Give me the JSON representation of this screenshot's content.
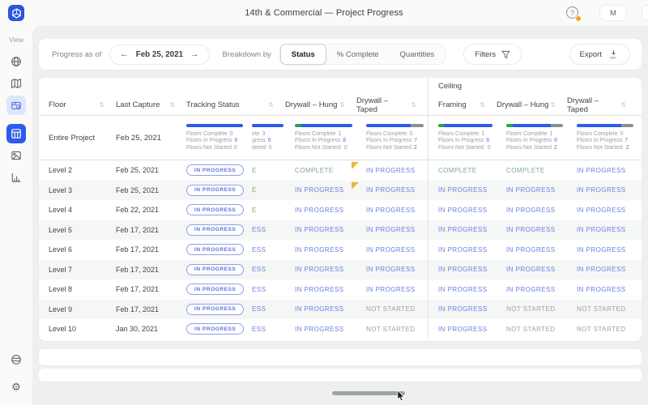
{
  "topbar": {
    "title": "14th & Commercial — Project Progress",
    "avatar_initial": "M"
  },
  "sidebar": {
    "view_label": "View",
    "items": [
      {
        "icon": "globe"
      },
      {
        "icon": "map"
      },
      {
        "icon": "capture-camera",
        "highlight": "soft"
      },
      {
        "icon": "progress-table",
        "highlight": "active"
      },
      {
        "icon": "photo-gallery"
      },
      {
        "icon": "bar-chart"
      }
    ],
    "bottom": [
      {
        "icon": "support-globe"
      },
      {
        "icon": "settings-gear"
      }
    ]
  },
  "toolbar": {
    "progress_as_of_label": "Progress as of",
    "prev_arrow": "←",
    "date": "Feb 25, 2021",
    "next_arrow": "→",
    "breakdown_label": "Breakdown by",
    "segments": [
      {
        "label": "Status",
        "selected": true
      },
      {
        "label": "% Complete",
        "selected": false
      },
      {
        "label": "Quantities",
        "selected": false
      }
    ],
    "filters_label": "Filters",
    "export_label": "Export",
    "export_format": "csv"
  },
  "colors": {
    "accent_blue": "#2d5bec",
    "bar_green": "#2ea052",
    "bar_gray": "#8b9097",
    "flag_yellow": "#f2b43c",
    "badge_orange": "#f5a623",
    "status_blue": "#6a7fe2",
    "status_green": "#7fab90",
    "status_gray": "#9da3a8"
  },
  "table": {
    "section_label": "Ceiling",
    "columns": [
      "Floor",
      "Last Capture",
      "Tracking Status",
      "Drywall – Hung",
      "Drywall – Taped",
      "Framing",
      "Drywall – Hung",
      "Drywall – Taped"
    ],
    "summary": {
      "floor": "Entire Project",
      "last_capture": "Feb 25, 2021",
      "metrics": [
        {
          "id": "tracking-status",
          "clipped": false,
          "bar": [
            {
              "color": "blue",
              "pct": 100
            }
          ],
          "stats": [
            {
              "label": "Floors Complete",
              "value": "0",
              "tone": "muted"
            },
            {
              "label": "Floors In Progress",
              "value": "9",
              "tone": "blue"
            },
            {
              "label": "Floors Not Started",
              "value": "0",
              "tone": "muted"
            }
          ]
        },
        {
          "id": "walls-framing-clipped",
          "clipped": true,
          "bar": [
            {
              "color": "blue",
              "pct": 100
            }
          ],
          "stats": [
            {
              "label": "ete",
              "value": "3",
              "tone": "muted"
            },
            {
              "label": "gress",
              "value": "6",
              "tone": "blue"
            },
            {
              "label": "tarted",
              "value": "0",
              "tone": "muted"
            }
          ]
        },
        {
          "id": "walls-drywall-hung",
          "clipped": false,
          "bar": [
            {
              "color": "green",
              "pct": 11
            },
            {
              "color": "blue",
              "pct": 89
            }
          ],
          "stats": [
            {
              "label": "Floors Complete",
              "value": "1",
              "tone": "green"
            },
            {
              "label": "Floors In Progress",
              "value": "8",
              "tone": "blue"
            },
            {
              "label": "Floors Not Started:",
              "value": "0",
              "tone": "muted"
            }
          ]
        },
        {
          "id": "walls-drywall-taped",
          "clipped": false,
          "bar": [
            {
              "color": "blue",
              "pct": 78
            },
            {
              "color": "gray",
              "pct": 22
            }
          ],
          "stats": [
            {
              "label": "Floors Complete",
              "value": "0",
              "tone": "muted"
            },
            {
              "label": "Floors In Progress",
              "value": "7",
              "tone": "blue"
            },
            {
              "label": "Floors Not Started",
              "value": "2",
              "tone": "dark"
            }
          ]
        },
        {
          "id": "ceiling-framing",
          "clipped": false,
          "bar": [
            {
              "color": "green",
              "pct": 11
            },
            {
              "color": "blue",
              "pct": 89
            }
          ],
          "stats": [
            {
              "label": "Floors Complete",
              "value": "1",
              "tone": "green"
            },
            {
              "label": "Floors In Progress",
              "value": "8",
              "tone": "blue"
            },
            {
              "label": "Floors Not Started:",
              "value": "0",
              "tone": "muted"
            }
          ]
        },
        {
          "id": "ceiling-drywall-hung",
          "clipped": false,
          "bar": [
            {
              "color": "green",
              "pct": 11
            },
            {
              "color": "blue",
              "pct": 67
            },
            {
              "color": "gray",
              "pct": 22
            }
          ],
          "stats": [
            {
              "label": "Floors Complete",
              "value": "1",
              "tone": "green"
            },
            {
              "label": "Floors In Progress",
              "value": "6",
              "tone": "blue"
            },
            {
              "label": "Floors Not Started",
              "value": "2",
              "tone": "dark"
            }
          ]
        },
        {
          "id": "ceiling-drywall-taped",
          "clipped": false,
          "bar": [
            {
              "color": "blue",
              "pct": 78
            },
            {
              "color": "gray",
              "pct": 22
            }
          ],
          "stats": [
            {
              "label": "Floors Complete",
              "value": "0",
              "tone": "muted"
            },
            {
              "label": "Floors In Progress",
              "value": "7",
              "tone": "blue"
            },
            {
              "label": "Floors Not Started:",
              "value": "2",
              "tone": "dark"
            }
          ]
        }
      ]
    },
    "rows": [
      {
        "floor": "Level 2",
        "last_capture": "Feb 25, 2021",
        "tracking_badge": "IN PROGRESS",
        "clipped": {
          "text": "E",
          "status": "COMPLETE"
        },
        "walls_hung": "COMPLETE",
        "walls_taped": "IN PROGRESS",
        "walls_taped_flag": true,
        "framing": "COMPLETE",
        "ceiling_hung": "COMPLETE",
        "ceiling_taped": "IN PROGRESS"
      },
      {
        "floor": "Level 3",
        "last_capture": "Feb 25, 2021",
        "tracking_badge": "IN PROGRESS",
        "clipped": {
          "text": "E",
          "status": "COMPLETE"
        },
        "walls_hung": "IN PROGRESS",
        "walls_taped": "IN PROGRESS",
        "walls_taped_flag": true,
        "framing": "IN PROGRESS",
        "ceiling_hung": "IN PROGRESS",
        "ceiling_taped": "IN PROGRESS"
      },
      {
        "floor": "Level 4",
        "last_capture": "Feb 22, 2021",
        "tracking_badge": "IN PROGRESS",
        "clipped": {
          "text": "E",
          "status": "COMPLETE"
        },
        "walls_hung": "IN PROGRESS",
        "walls_taped": "IN PROGRESS",
        "walls_taped_flag": false,
        "framing": "IN PROGRESS",
        "ceiling_hung": "IN PROGRESS",
        "ceiling_taped": "IN PROGRESS"
      },
      {
        "floor": "Level 5",
        "last_capture": "Feb 17, 2021",
        "tracking_badge": "IN PROGRESS",
        "clipped": {
          "text": "ESS",
          "status": "IN PROGRESS"
        },
        "walls_hung": "IN PROGRESS",
        "walls_taped": "IN PROGRESS",
        "walls_taped_flag": false,
        "framing": "IN PROGRESS",
        "ceiling_hung": "IN PROGRESS",
        "ceiling_taped": "IN PROGRESS"
      },
      {
        "floor": "Level 6",
        "last_capture": "Feb 17, 2021",
        "tracking_badge": "IN PROGRESS",
        "clipped": {
          "text": "ESS",
          "status": "IN PROGRESS"
        },
        "walls_hung": "IN PROGRESS",
        "walls_taped": "IN PROGRESS",
        "walls_taped_flag": false,
        "framing": "IN PROGRESS",
        "ceiling_hung": "IN PROGRESS",
        "ceiling_taped": "IN PROGRESS"
      },
      {
        "floor": "Level 7",
        "last_capture": "Feb 17, 2021",
        "tracking_badge": "IN PROGRESS",
        "clipped": {
          "text": "ESS",
          "status": "IN PROGRESS"
        },
        "walls_hung": "IN PROGRESS",
        "walls_taped": "IN PROGRESS",
        "walls_taped_flag": false,
        "framing": "IN PROGRESS",
        "ceiling_hung": "IN PROGRESS",
        "ceiling_taped": "IN PROGRESS"
      },
      {
        "floor": "Level 8",
        "last_capture": "Feb 17, 2021",
        "tracking_badge": "IN PROGRESS",
        "clipped": {
          "text": "ESS",
          "status": "IN PROGRESS"
        },
        "walls_hung": "IN PROGRESS",
        "walls_taped": "IN PROGRESS",
        "walls_taped_flag": false,
        "framing": "IN PROGRESS",
        "ceiling_hung": "IN PROGRESS",
        "ceiling_taped": "IN PROGRESS"
      },
      {
        "floor": "Level 9",
        "last_capture": "Feb 17, 2021",
        "tracking_badge": "IN PROGRESS",
        "clipped": {
          "text": "ESS",
          "status": "IN PROGRESS"
        },
        "walls_hung": "IN PROGRESS",
        "walls_taped": "NOT STARTED",
        "walls_taped_flag": false,
        "framing": "IN PROGRESS",
        "ceiling_hung": "NOT STARTED",
        "ceiling_taped": "NOT STARTED"
      },
      {
        "floor": "Level 10",
        "last_capture": "Jan 30, 2021",
        "tracking_badge": "IN PROGRESS",
        "clipped": {
          "text": "ESS",
          "status": "IN PROGRESS"
        },
        "walls_hung": "IN PROGRESS",
        "walls_taped": "NOT STARTED",
        "walls_taped_flag": false,
        "framing": "IN PROGRESS",
        "ceiling_hung": "NOT STARTED",
        "ceiling_taped": "NOT STARTED"
      }
    ]
  }
}
